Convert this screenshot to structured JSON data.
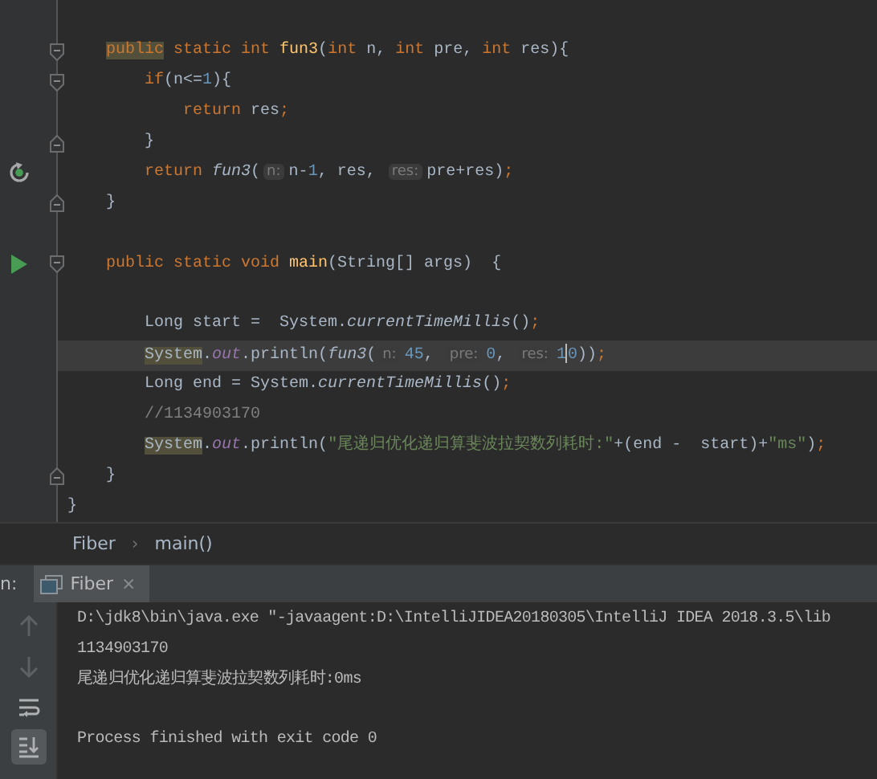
{
  "editor": {
    "lines": [
      {
        "kind": "text",
        "current": false
      },
      {
        "kind": "fold_start",
        "current": false,
        "tokens": [
          {
            "kind": "keyword",
            "text": "public",
            "highlighted": true
          },
          {
            "kind": "keyword",
            "text": " static int ",
            "highlighted": false
          },
          {
            "kind": "declaration",
            "text": "fun3",
            "highlighted": false
          },
          {
            "kind": "plain",
            "text": "(",
            "highlighted": false
          },
          {
            "kind": "keyword",
            "text": "int ",
            "highlighted": false
          },
          {
            "kind": "plain",
            "text": "n, ",
            "highlighted": false
          },
          {
            "kind": "keyword",
            "text": "int ",
            "highlighted": false
          },
          {
            "kind": "plain",
            "text": "pre, ",
            "highlighted": false
          },
          {
            "kind": "keyword",
            "text": "int ",
            "highlighted": false
          },
          {
            "kind": "plain",
            "text": "res){",
            "highlighted": false
          }
        ]
      },
      {
        "kind": "fold_start",
        "current": false,
        "tokens": [
          {
            "kind": "keyword",
            "text": "if",
            "highlighted": false
          },
          {
            "kind": "plain",
            "text": "(n<=",
            "highlighted": false
          },
          {
            "kind": "number",
            "text": "1",
            "highlighted": false
          },
          {
            "kind": "plain",
            "text": "){",
            "highlighted": false
          }
        ]
      },
      {
        "kind": "text",
        "current": false,
        "tokens": [
          {
            "kind": "keyword",
            "text": "return ",
            "highlighted": false
          },
          {
            "kind": "plain",
            "text": "res",
            "highlighted": false
          },
          {
            "kind": "keyword",
            "text": ";",
            "highlighted": false
          }
        ]
      },
      {
        "kind": "fold_end",
        "current": false,
        "tokens": [
          {
            "kind": "plain",
            "text": "}",
            "highlighted": false
          }
        ]
      },
      {
        "kind": "recursive_call",
        "current": false,
        "tokens": [
          {
            "kind": "keyword",
            "text": "return ",
            "highlighted": false
          },
          {
            "kind": "call",
            "text": "fun3",
            "highlighted": false
          },
          {
            "kind": "plain",
            "text": "(",
            "highlighted": false
          },
          {
            "kind": "hint",
            "text": "n:",
            "highlighted": false
          },
          {
            "kind": "plain",
            "text": "n-",
            "highlighted": false
          },
          {
            "kind": "number",
            "text": "1",
            "highlighted": false
          },
          {
            "kind": "plain",
            "text": ", res, ",
            "highlighted": false
          },
          {
            "kind": "hint",
            "text": "res:",
            "highlighted": false
          },
          {
            "kind": "plain",
            "text": "pre+res)",
            "highlighted": false
          },
          {
            "kind": "keyword",
            "text": ";",
            "highlighted": false
          }
        ]
      },
      {
        "kind": "fold_end",
        "current": false,
        "tokens": [
          {
            "kind": "plain",
            "text": "}",
            "highlighted": false
          }
        ]
      },
      {
        "kind": "text",
        "current": false
      },
      {
        "kind": "entry_point",
        "current": false,
        "tokens": [
          {
            "kind": "keyword",
            "text": "public static void ",
            "highlighted": false
          },
          {
            "kind": "declaration",
            "text": "main",
            "highlighted": false
          },
          {
            "kind": "plain",
            "text": "(String[] args)  {",
            "highlighted": false
          }
        ]
      },
      {
        "kind": "text",
        "current": false
      },
      {
        "kind": "text",
        "current": false,
        "tokens": [
          {
            "kind": "plain",
            "text": "Long start =  System.",
            "highlighted": false
          },
          {
            "kind": "call",
            "text": "currentTimeMillis",
            "highlighted": false
          },
          {
            "kind": "plain",
            "text": "()",
            "highlighted": false
          },
          {
            "kind": "keyword",
            "text": ";",
            "highlighted": false
          }
        ]
      },
      {
        "kind": "text",
        "current": true,
        "tokens": [
          {
            "kind": "plain",
            "text": "System",
            "highlighted": true
          },
          {
            "kind": "plain",
            "text": ".",
            "highlighted": false
          },
          {
            "kind": "field",
            "text": "out",
            "highlighted": false
          },
          {
            "kind": "plain",
            "text": ".println(",
            "highlighted": false
          },
          {
            "kind": "call",
            "text": "fun3",
            "highlighted": false
          },
          {
            "kind": "plain",
            "text": "(",
            "highlighted": false
          },
          {
            "kind": "hint",
            "text": "n:",
            "highlighted": false
          },
          {
            "kind": "number",
            "text": "45",
            "highlighted": false
          },
          {
            "kind": "plain",
            "text": ", ",
            "highlighted": false
          },
          {
            "kind": "hint",
            "text": "pre:",
            "highlighted": false
          },
          {
            "kind": "number",
            "text": "0",
            "highlighted": false
          },
          {
            "kind": "plain",
            "text": ", ",
            "highlighted": false
          },
          {
            "kind": "hint",
            "text": "res:",
            "highlighted": false
          },
          {
            "kind": "number",
            "text": "1",
            "highlighted": false
          },
          {
            "kind": "caret",
            "highlighted": false
          },
          {
            "kind": "number",
            "text": "0",
            "highlighted": false
          },
          {
            "kind": "plain",
            "text": "))",
            "highlighted": false
          },
          {
            "kind": "keyword",
            "text": ";",
            "highlighted": false
          }
        ]
      },
      {
        "kind": "text",
        "current": false,
        "tokens": [
          {
            "kind": "plain",
            "text": "Long end = System.",
            "highlighted": false
          },
          {
            "kind": "call",
            "text": "currentTimeMillis",
            "highlighted": false
          },
          {
            "kind": "plain",
            "text": "()",
            "highlighted": false
          },
          {
            "kind": "keyword",
            "text": ";",
            "highlighted": false
          }
        ]
      },
      {
        "kind": "text",
        "current": false,
        "tokens": [
          {
            "kind": "comment",
            "text": "//1134903170",
            "highlighted": false
          }
        ]
      },
      {
        "kind": "text",
        "current": false,
        "tokens": [
          {
            "kind": "plain",
            "text": "System",
            "highlighted": true
          },
          {
            "kind": "plain",
            "text": ".",
            "highlighted": false
          },
          {
            "kind": "field",
            "text": "out",
            "highlighted": false
          },
          {
            "kind": "plain",
            "text": ".println(",
            "highlighted": false
          },
          {
            "kind": "string",
            "text": "\"尾递归优化递归算斐波拉契数列耗时:\"",
            "highlighted": false
          },
          {
            "kind": "plain",
            "text": "+(end -  start)+",
            "highlighted": false
          },
          {
            "kind": "string",
            "text": "\"ms\"",
            "highlighted": false
          },
          {
            "kind": "plain",
            "text": ")",
            "highlighted": false
          },
          {
            "kind": "keyword",
            "text": ";",
            "highlighted": false
          }
        ]
      },
      {
        "kind": "fold_end",
        "current": false,
        "tokens": [
          {
            "kind": "plain",
            "text": "}",
            "highlighted": false
          }
        ]
      },
      {
        "kind": "text",
        "current": false,
        "tokens": [
          {
            "kind": "plain",
            "text": "}",
            "highlighted": false
          }
        ]
      }
    ]
  },
  "breadcrumbs": {
    "separator": "›",
    "items": [
      "Fiber",
      "main()"
    ]
  },
  "run_panel": {
    "label": "n:",
    "tabs": [
      {
        "label": "Fiber",
        "close": "×",
        "selected": true
      }
    ],
    "tools": [
      {
        "kind": "up",
        "disabled": true,
        "selected": false
      },
      {
        "kind": "down",
        "disabled": true,
        "selected": false
      },
      {
        "kind": "wrap",
        "disabled": false,
        "selected": false
      },
      {
        "kind": "scroll_end",
        "disabled": false,
        "selected": true
      }
    ],
    "console": [
      {
        "kind": "command",
        "text": "D:\\jdk8\\bin\\java.exe \"-javaagent:D:\\IntelliJIDEA20180305\\IntelliJ IDEA 2018.3.5\\lib"
      },
      {
        "kind": "output",
        "text": "1134903170"
      },
      {
        "kind": "output",
        "text": "尾递归优化递归算斐波拉契数列耗时:0ms"
      },
      {
        "kind": "exit",
        "text": "Process finished with exit code 0"
      }
    ]
  }
}
